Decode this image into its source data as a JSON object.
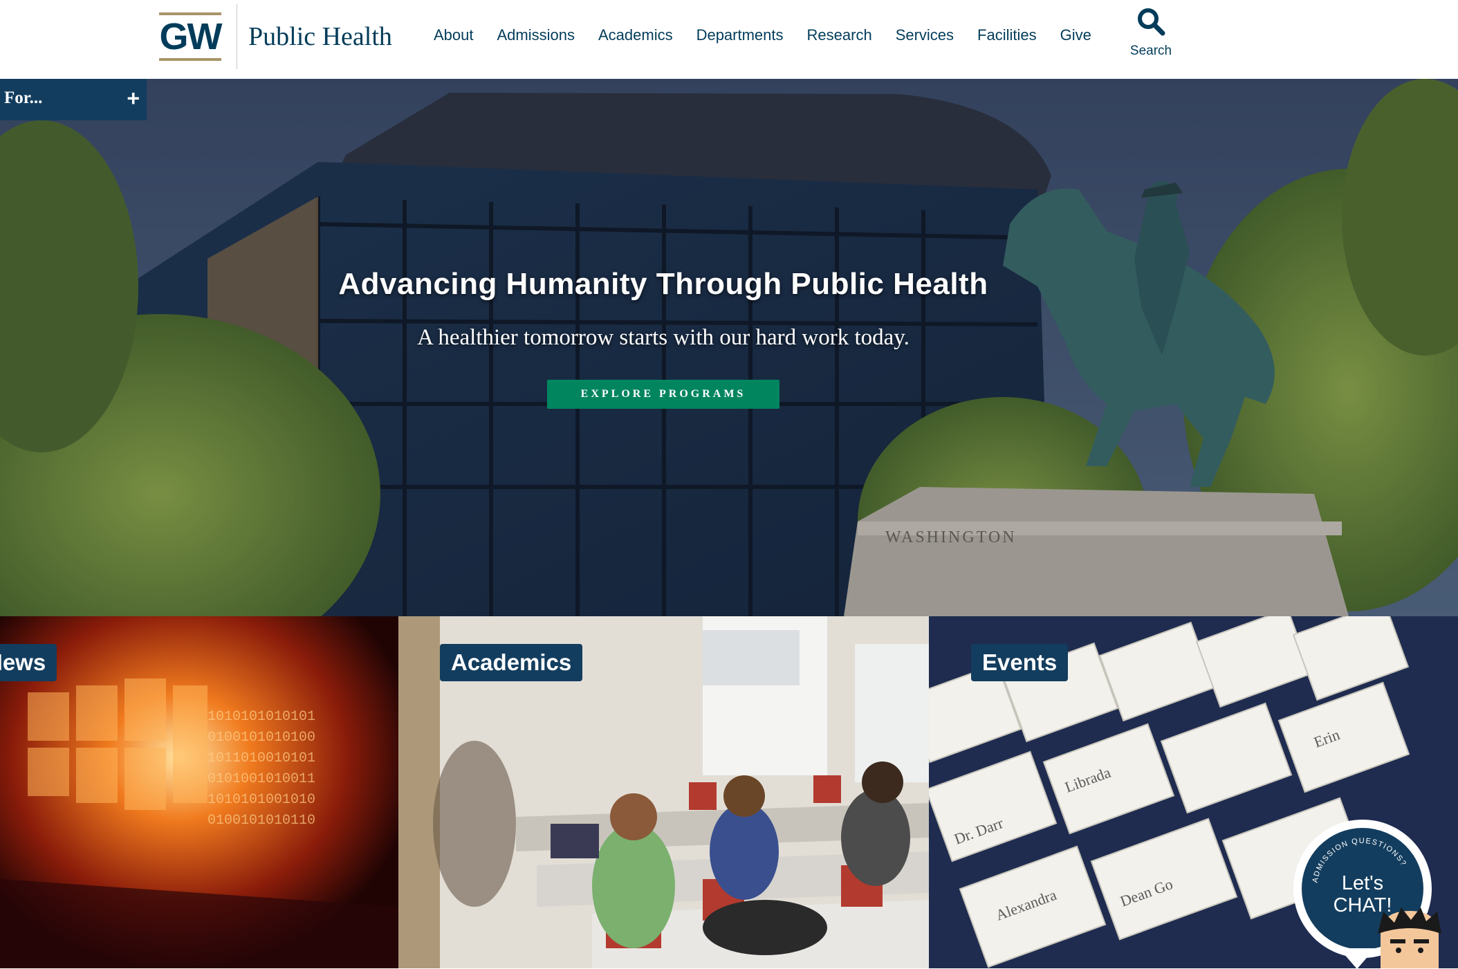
{
  "header": {
    "logo_mark": "GW",
    "logo_text": "Public Health",
    "nav": [
      "About",
      "Admissions",
      "Academics",
      "Departments",
      "Research",
      "Services",
      "Facilities",
      "Give"
    ],
    "search_label": "Search",
    "search_icon": "search-icon"
  },
  "for_panel": {
    "label": "For...",
    "toggle": "+"
  },
  "hero": {
    "title": "Advancing Humanity Through Public Health",
    "subtitle": "A healthier tomorrow starts with our hard work today.",
    "button": "EXPLORE PROGRAMS",
    "statue_inscription": "WASHINGTON"
  },
  "tiles": [
    {
      "label": "News"
    },
    {
      "label": "Academics"
    },
    {
      "label": "Events"
    }
  ],
  "chat": {
    "arc_text": "ADMISSION QUESTIONS?",
    "line1": "Let's",
    "line2": "CHAT!"
  },
  "colors": {
    "navy": "#033c5a",
    "gold": "#a89466",
    "green": "#00855f",
    "label_bg": "#133d5e"
  }
}
